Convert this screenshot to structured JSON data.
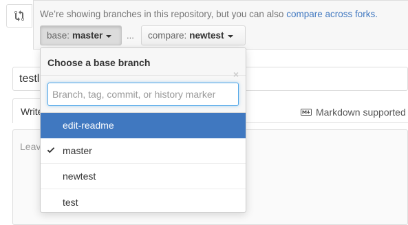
{
  "range": {
    "icon": "git-compare-icon",
    "notice_text": "We’re showing branches in this repository, but you can also ",
    "notice_link": "compare across forks.",
    "base_prefix": "base:",
    "base_value": "master",
    "ellipsis": "...",
    "compare_prefix": "compare:",
    "compare_value": "newtest"
  },
  "form": {
    "title_value": "testli",
    "tab_write": "Write",
    "markdown_hint": "Markdown supported",
    "markdown_icon": "markdown-icon",
    "textarea_placeholder": "Leav"
  },
  "menu": {
    "title": "Choose a base branch",
    "close_glyph": "×",
    "filter_placeholder": "Branch, tag, commit, or history marker",
    "items": [
      {
        "label": "edit-readme",
        "selected": false,
        "focused": true
      },
      {
        "label": "master",
        "selected": true,
        "focused": false
      },
      {
        "label": "newtest",
        "selected": false,
        "focused": false
      },
      {
        "label": "test",
        "selected": false,
        "focused": false
      }
    ]
  },
  "colors": {
    "link": "#4078c0",
    "focus_bg": "#4078c0"
  }
}
